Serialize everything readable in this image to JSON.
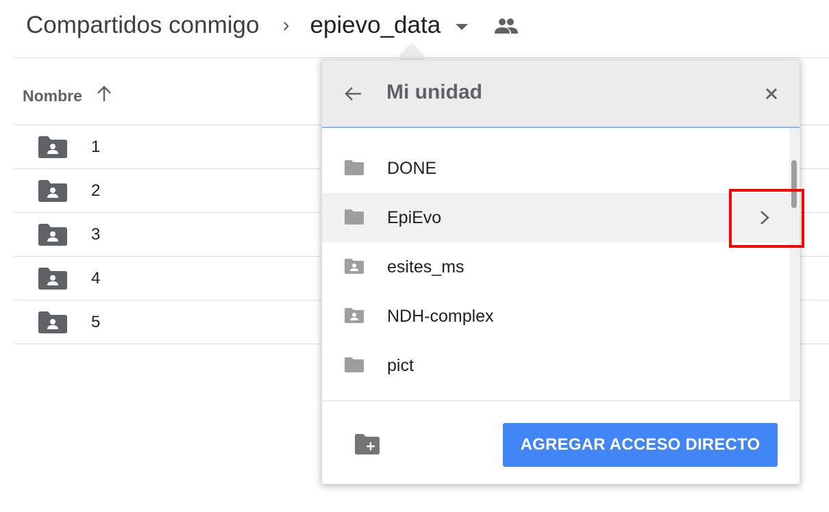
{
  "breadcrumb": {
    "root": "Compartidos conmigo",
    "separator": "›",
    "current": "epievo_data"
  },
  "list": {
    "header": "Nombre",
    "sort_icon": "arrow-up-icon",
    "rows": [
      {
        "name": "1",
        "icon": "shared-folder-icon"
      },
      {
        "name": "2",
        "icon": "shared-folder-icon"
      },
      {
        "name": "3",
        "icon": "shared-folder-icon"
      },
      {
        "name": "4",
        "icon": "shared-folder-icon"
      },
      {
        "name": "5",
        "icon": "shared-folder-icon"
      }
    ]
  },
  "dialog": {
    "title": "Mi unidad",
    "back_icon": "arrow-back-icon",
    "close_icon": "close-icon",
    "folders": [
      {
        "name": "DONE",
        "icon": "folder-icon"
      },
      {
        "name": "EpiEvo",
        "icon": "folder-icon",
        "highlighted": true,
        "chevron": "chevron-right-icon"
      },
      {
        "name": "esites_ms",
        "icon": "shared-folder-icon"
      },
      {
        "name": "NDH-complex",
        "icon": "shared-folder-icon"
      },
      {
        "name": "pict",
        "icon": "folder-icon"
      }
    ],
    "new_folder_icon": "new-folder-icon",
    "primary_button": "AGREGAR ACCESO DIRECTO"
  },
  "colors": {
    "primary": "#4285f4",
    "highlight_box": "#ff0000",
    "icon_gray": "#9e9e9e",
    "list_icon": "#5f6368"
  }
}
